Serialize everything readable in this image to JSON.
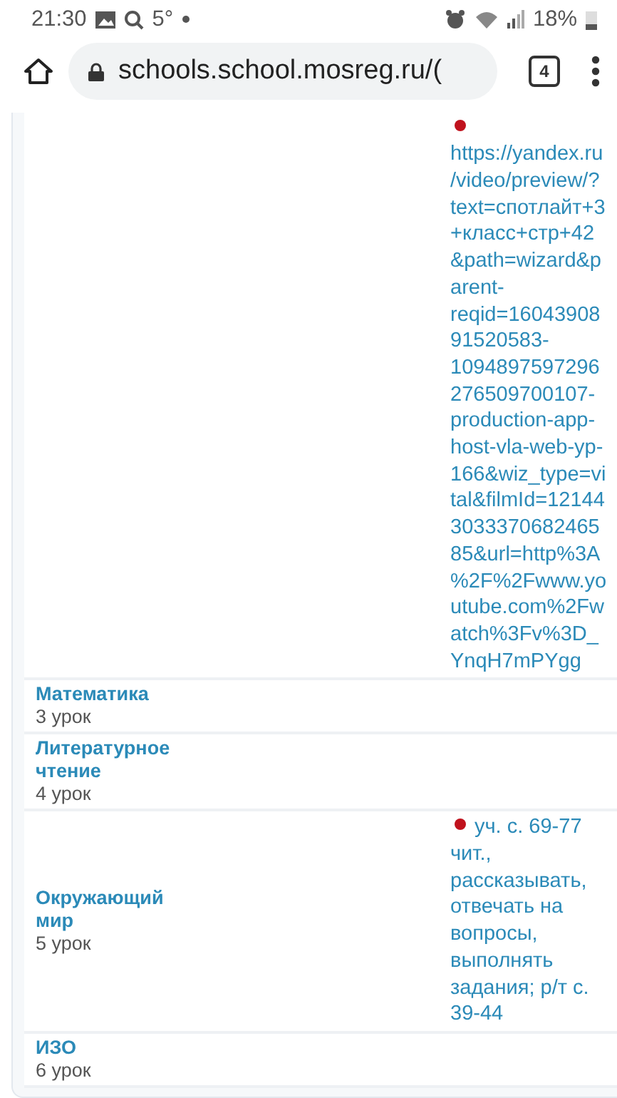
{
  "status_bar": {
    "time": "21:30",
    "temperature": "5°",
    "battery": "18%"
  },
  "browser": {
    "url": "schools.school.mosreg.ru/(",
    "tab_count": "4"
  },
  "lessons": [
    {
      "homework": "https://yandex.ru/video/preview/?text=спотлайт+3+класс+стр+42&path=wizard&parent-reqid=1604390891520583-1094897597296276509700107-production-app-host-vla-web-yp-166&wiz_type=vital&filmId=12144303337068246585&url=http%3A%2F%2Fwww.youtube.com%2Fwatch%3Fv%3D_YnqH7mPYgg"
    },
    {
      "subject": "Математика",
      "number": "3 урок"
    },
    {
      "subject": "Литературное чтение",
      "number": "4 урок"
    },
    {
      "subject": "Окружающий мир",
      "number": "5 урок",
      "homework": "уч. с. 69-77 чит., рассказывать, отвечать на вопросы, выполнять задания; р/т с. 39-44"
    },
    {
      "subject": "ИЗО",
      "number": "6 урок"
    }
  ]
}
